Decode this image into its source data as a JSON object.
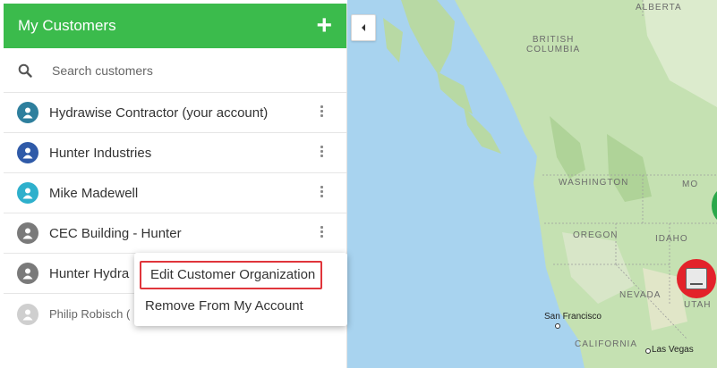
{
  "sidebar": {
    "title": "My Customers",
    "add_icon": "plus-icon",
    "search": {
      "placeholder": "Search customers",
      "icon": "search-icon"
    },
    "customers": [
      {
        "name": "Hydrawise Contractor (your account)",
        "avatar_color": "#2e7f9d",
        "menu_icon": "kebab-menu-icon"
      },
      {
        "name": "Hunter Industries",
        "avatar_color": "#2f5aa8",
        "menu_icon": "kebab-menu-icon"
      },
      {
        "name": "Mike Madewell",
        "avatar_color": "#2eb0cc",
        "menu_icon": "kebab-menu-icon"
      },
      {
        "name": "CEC Building - Hunter",
        "avatar_color": "#7a7a7a",
        "menu_icon": "kebab-menu-icon"
      },
      {
        "name": "Hunter Hydra",
        "avatar_color": "#7a7a7a"
      },
      {
        "name": "Philip Robisch (",
        "avatar_color": "#cfcfcf"
      }
    ]
  },
  "collapse_icon": "caret-left-icon",
  "context_menu": {
    "items": [
      "Edit Customer Organization",
      "Remove From My Account"
    ],
    "highlight_color": "#e0353b"
  },
  "map": {
    "labels": [
      "ALBERTA",
      "BRITISH\nCOLUMBIA",
      "WASHINGTON",
      "MO",
      "OREGON",
      "IDAHO",
      "NEVADA",
      "UTAH",
      "CALIFORNIA"
    ],
    "cities": [
      "San Francisco",
      "Las Vegas"
    ],
    "markers": [
      {
        "icon": "controller-icon",
        "color": "#e3222a"
      },
      {
        "color": "#2aa84a"
      }
    ]
  },
  "colors": {
    "header": "#3bbb4c",
    "water": "#a8d3ef",
    "land": "#c5e1b2"
  }
}
